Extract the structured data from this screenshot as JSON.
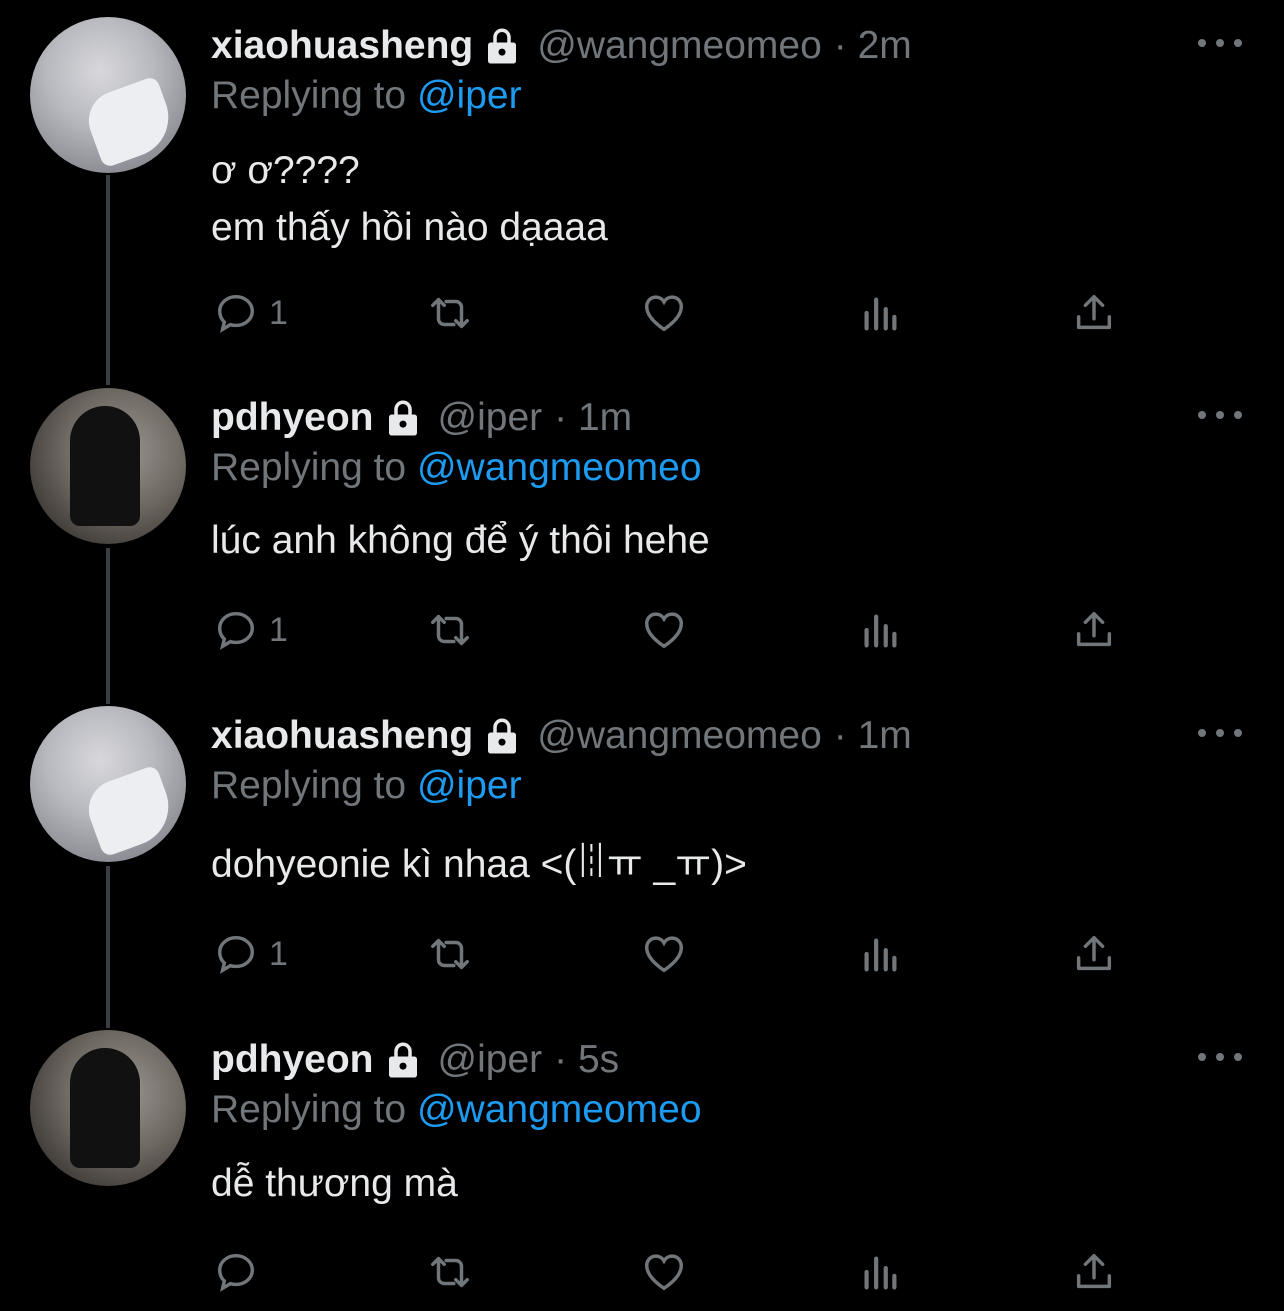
{
  "tweets": [
    {
      "name": "xiaohuasheng",
      "handle": "@wangmeomeo",
      "time": "· 2m",
      "replying_prefix": "Replying to",
      "replying_to": "@iper",
      "text": "ơ ơ????\nem thấy hồi nào dạaaa",
      "reply_count": "1",
      "avatar": "avatar-xiaohuasheng"
    },
    {
      "name": "pdhyeon",
      "handle": "@iper",
      "time": "· 1m",
      "replying_prefix": "Replying to",
      "replying_to": "@wangmeomeo",
      "text": "lúc anh không để ý thôi hehe",
      "reply_count": "1",
      "avatar": "avatar-pdhyeon"
    },
    {
      "name": "xiaohuasheng",
      "handle": "@wangmeomeo",
      "time": "· 1m",
      "replying_prefix": "Replying to",
      "replying_to": "@iper",
      "text": "dohyeonie kì nhaa <(ꈨㅠ _ㅠ)>",
      "reply_count": "1",
      "avatar": "avatar-xiaohuasheng"
    },
    {
      "name": "pdhyeon",
      "handle": "@iper",
      "time": "· 5s",
      "replying_prefix": "Replying to",
      "replying_to": "@wangmeomeo",
      "text": "dễ thương mà",
      "reply_count": "",
      "avatar": "avatar-pdhyeon"
    }
  ],
  "colors": {
    "background": "#000000",
    "text": "#e7e9ea",
    "muted": "#71767b",
    "accent": "#1d9bf0"
  },
  "icons": [
    "lock-icon",
    "more-icon",
    "reply-icon",
    "retweet-icon",
    "like-icon",
    "analytics-icon",
    "share-icon"
  ]
}
